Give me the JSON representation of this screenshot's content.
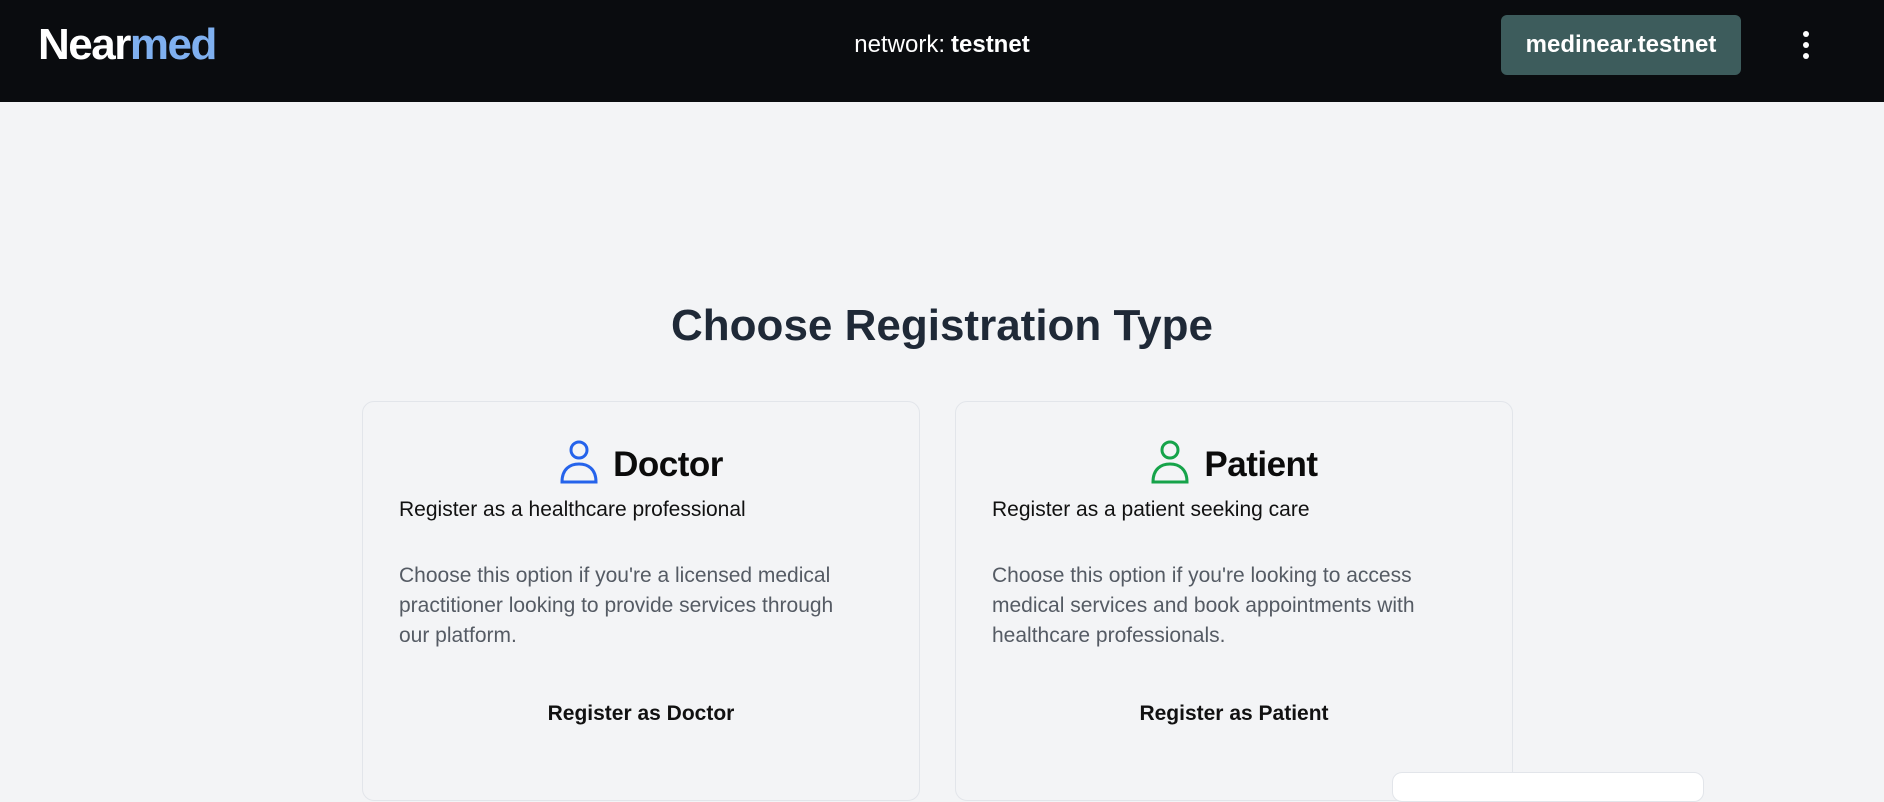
{
  "header": {
    "logo_part1": "Near",
    "logo_part2": "med",
    "network_prefix": "network:",
    "network_value": "testnet",
    "account_label": "medinear.testnet",
    "more_icon": "more-vertical-icon"
  },
  "main": {
    "title": "Choose Registration Type",
    "cards": [
      {
        "icon": "user-icon",
        "icon_color": "#2563eb",
        "title": "Doctor",
        "subtitle": "Register as a healthcare professional",
        "description": "Choose this option if you're a licensed medical practitioner looking to provide services through our platform.",
        "action_label": "Register as Doctor"
      },
      {
        "icon": "user-icon",
        "icon_color": "#16a34a",
        "title": "Patient",
        "subtitle": "Register as a patient seeking care",
        "description": "Choose this option if you're looking to access medical services and book appointments with healthcare professionals.",
        "action_label": "Register as Patient"
      }
    ]
  },
  "colors": {
    "navbar_bg": "#0a0c0f",
    "logo_accent": "#7fb0f0",
    "account_button_bg": "#3d5c5c",
    "page_bg": "#f3f4f6"
  }
}
